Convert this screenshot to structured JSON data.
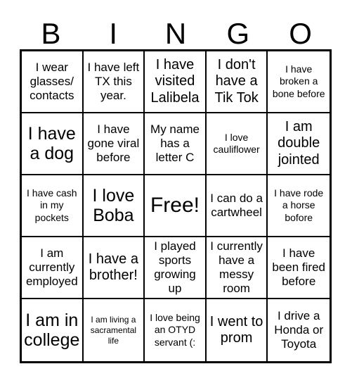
{
  "card": {
    "title_letters": [
      "B",
      "I",
      "N",
      "G",
      "O"
    ],
    "columns": 5,
    "rows": 5,
    "free_space_index": 12,
    "colors": {
      "background": "#ffffff",
      "text": "#000000",
      "grid_line": "#000000"
    },
    "cells": [
      {
        "text": "I wear glasses/ contacts",
        "size": "fs-md"
      },
      {
        "text": "I have left TX this year.",
        "size": "fs-md"
      },
      {
        "text": "I have visited Lalibela",
        "size": "fs-lg"
      },
      {
        "text": "I don't have a Tik Tok",
        "size": "fs-lg"
      },
      {
        "text": "I have broken a bone before",
        "size": "fs-sm"
      },
      {
        "text": "I have a dog",
        "size": "fs-xl"
      },
      {
        "text": "I have gone viral before",
        "size": "fs-md"
      },
      {
        "text": "My name has a letter C",
        "size": "fs-md"
      },
      {
        "text": "I love cauliflower",
        "size": "fs-sm"
      },
      {
        "text": "I am double jointed",
        "size": "fs-lg"
      },
      {
        "text": "I have cash in my pockets",
        "size": "fs-sm"
      },
      {
        "text": "I love Boba",
        "size": "fs-xl"
      },
      {
        "text": "Free!",
        "size": "fs-xxl"
      },
      {
        "text": "I can do a cartwheel",
        "size": "fs-md"
      },
      {
        "text": "I have rode a horse bofore",
        "size": "fs-sm"
      },
      {
        "text": "I am currently employed",
        "size": "fs-md"
      },
      {
        "text": "I have a brother!",
        "size": "fs-lg"
      },
      {
        "text": "I played sports growing up",
        "size": "fs-md"
      },
      {
        "text": "I currently have a messy room",
        "size": "fs-md"
      },
      {
        "text": "I have been fired before",
        "size": "fs-md"
      },
      {
        "text": "I am in college",
        "size": "fs-xl"
      },
      {
        "text": "I am living a sacramental life",
        "size": "fs-xs"
      },
      {
        "text": "I love being an OTYD servant (:",
        "size": "fs-sm"
      },
      {
        "text": "I went to prom",
        "size": "fs-lg"
      },
      {
        "text": "I drive a Honda or Toyota",
        "size": "fs-md"
      }
    ]
  }
}
